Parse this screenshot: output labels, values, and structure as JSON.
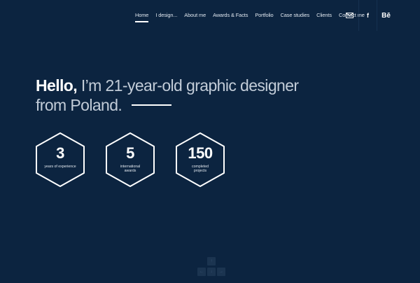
{
  "nav": {
    "items": [
      {
        "label": "Home",
        "active": true
      },
      {
        "label": "I design..."
      },
      {
        "label": "About me"
      },
      {
        "label": "Awards & Facts"
      },
      {
        "label": "Portfolio"
      },
      {
        "label": "Case studies"
      },
      {
        "label": "Clients"
      },
      {
        "label": "Contact me"
      }
    ]
  },
  "social": {
    "mail_icon": "envelope-icon",
    "facebook_label": "f",
    "behance_label": "Bē"
  },
  "hero": {
    "hello": "Hello,",
    "line1_rest": " I’m 21-year-old graphic designer",
    "line2": "from Poland."
  },
  "stats": [
    {
      "number": "3",
      "label": "years of experience"
    },
    {
      "number": "5",
      "label": "international awards"
    },
    {
      "number": "150",
      "label": "completed projects"
    }
  ],
  "keys": {
    "up": "↑",
    "left": "←",
    "down": "↓",
    "right": "→"
  },
  "colors": {
    "background": "#0c2440",
    "text": "#ffffff",
    "muted": "#c2ccd8"
  }
}
